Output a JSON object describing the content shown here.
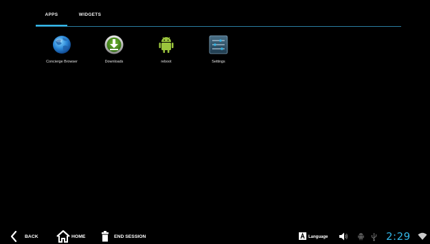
{
  "tabs": [
    {
      "label": "APPS",
      "selected": true
    },
    {
      "label": "WIDGETS",
      "selected": false
    }
  ],
  "apps": [
    {
      "label": "Concierge Browser",
      "icon": "globe-icon"
    },
    {
      "label": "Downloads",
      "icon": "download-icon"
    },
    {
      "label": "reboot",
      "icon": "android-icon"
    },
    {
      "label": "Settings",
      "icon": "settings-sliders-icon"
    }
  ],
  "navbar": {
    "back_label": "BACK",
    "home_label": "HOME",
    "end_session_label": "END SESSION",
    "language_label": "Language",
    "time": "2:29"
  },
  "colors": {
    "accent": "#33b5e5",
    "background": "#000000"
  }
}
